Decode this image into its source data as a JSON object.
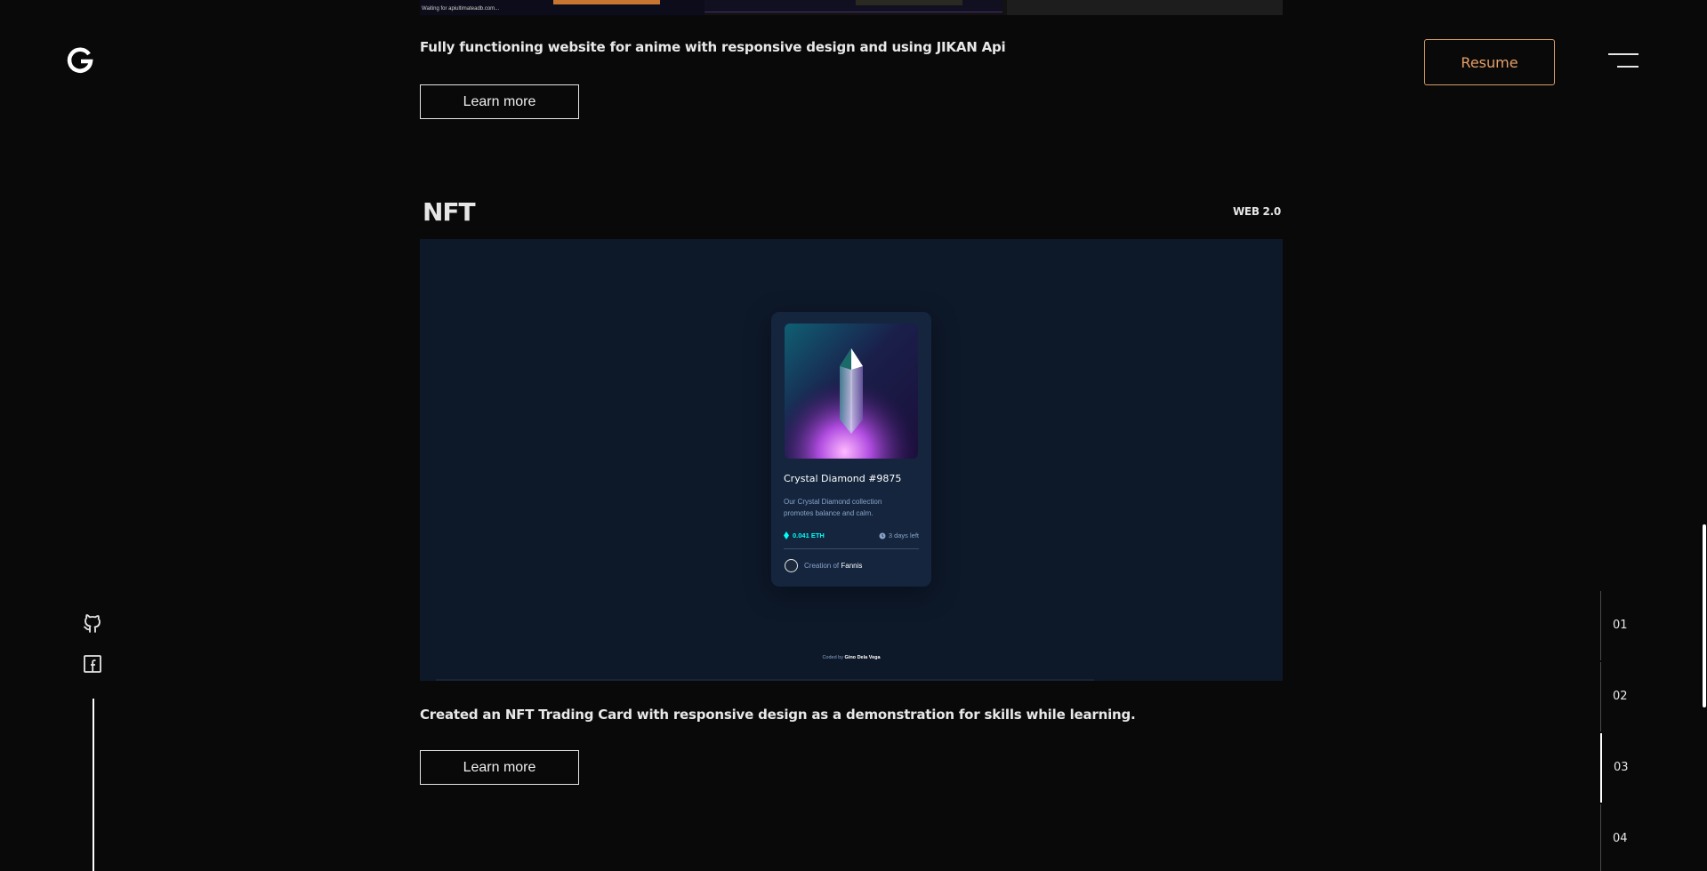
{
  "header": {
    "logo_icon": "g-logo-icon",
    "resume_label": "Resume",
    "menu_icon": "hamburger-menu-icon",
    "accent_color": "#e6a167"
  },
  "social": [
    {
      "name": "github-icon"
    },
    {
      "name": "facebook-icon"
    }
  ],
  "previous_project": {
    "preview_caption": "Waiting for apiultimateadb.com...",
    "description": "Fully functioning website for anime with responsive design and using JIKAN Api",
    "button_label": "Learn more"
  },
  "project": {
    "title": "NFT",
    "tag": "WEB 2.0",
    "description": "Created an NFT Trading Card with responsive design as a demonstration for skills while learning.",
    "button_label": "Learn more",
    "preview": {
      "card_title": "Crystal Diamond #9875",
      "card_description": "Our Crystal Diamond collection promotes balance and calm.",
      "price": "0.041 ETH",
      "time_left": "3 days left",
      "creator_prefix": "Creation of",
      "creator_name": "Fannis",
      "coded_by_prefix": "Coded by",
      "coded_by_name": "Gino Dela Vega"
    }
  },
  "section_index": [
    {
      "label": "01",
      "active": false
    },
    {
      "label": "02",
      "active": false
    },
    {
      "label": "03",
      "active": true
    },
    {
      "label": "04",
      "active": false
    }
  ]
}
